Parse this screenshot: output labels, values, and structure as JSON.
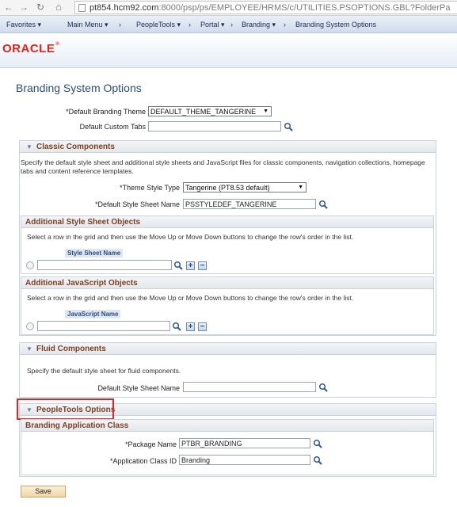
{
  "browser": {
    "url_host": "pt854.hcm92.com",
    "url_rest": ":8000/psp/ps/EMPLOYEE/HRMS/c/UTILITIES.PSOPTIONS.GBL?FolderPa"
  },
  "menu": {
    "favorites": "Favorites ▾",
    "main_menu": "Main Menu ▾",
    "sep1": "›",
    "peopletools": "PeopleTools ▾",
    "sep2": "›",
    "portal": "Portal ▾",
    "sep3": "›",
    "branding": "Branding ▾",
    "sep4": "›",
    "current": "Branding System Options"
  },
  "logo": {
    "text": "ORACLE",
    "reg": "®"
  },
  "page": {
    "title": "Branding System Options",
    "default_theme_label": "*Default Branding Theme",
    "default_theme_value": "DEFAULT_THEME_TANGERINE",
    "default_tabs_label": "Default Custom Tabs",
    "default_tabs_value": ""
  },
  "classic": {
    "title": "Classic Components",
    "description": "Specify the default style sheet and additional style sheets and JavaScript files for classic components, navigation collections, homepage tabs and content reference templates.",
    "theme_style_type_label": "*Theme Style Type",
    "theme_style_type_value": "Tangerine (PT8.53 default)",
    "style_sheet_label": "*Default Style Sheet Name",
    "style_sheet_value": "PSSTYLEDEF_TANGERINE",
    "addl_style": {
      "title": "Additional Style Sheet Objects",
      "instructions": "Select a row in the grid and then use the Move Up or Move Down buttons to change the row's order in the list.",
      "column": "Style Sheet Name",
      "value": ""
    },
    "addl_js": {
      "title": "Additional JavaScript Objects",
      "instructions": "Select a row in the grid and then use the Move Up or Move Down buttons to change the row's order in the list.",
      "column": "JavaScript Name",
      "value": ""
    }
  },
  "fluid": {
    "title": "Fluid Components",
    "description": "Specify the default style sheet for fluid components.",
    "style_sheet_label": "Default Style Sheet Name",
    "style_sheet_value": ""
  },
  "peopletools_options": {
    "title": "PeopleTools Options",
    "app_class_title": "Branding Application Class",
    "package_label": "*Package Name",
    "package_value": "PTBR_BRANDING",
    "class_label": "*Application Class ID",
    "class_value": "Branding"
  },
  "actions": {
    "save": "Save",
    "add": "+",
    "remove": "−"
  }
}
